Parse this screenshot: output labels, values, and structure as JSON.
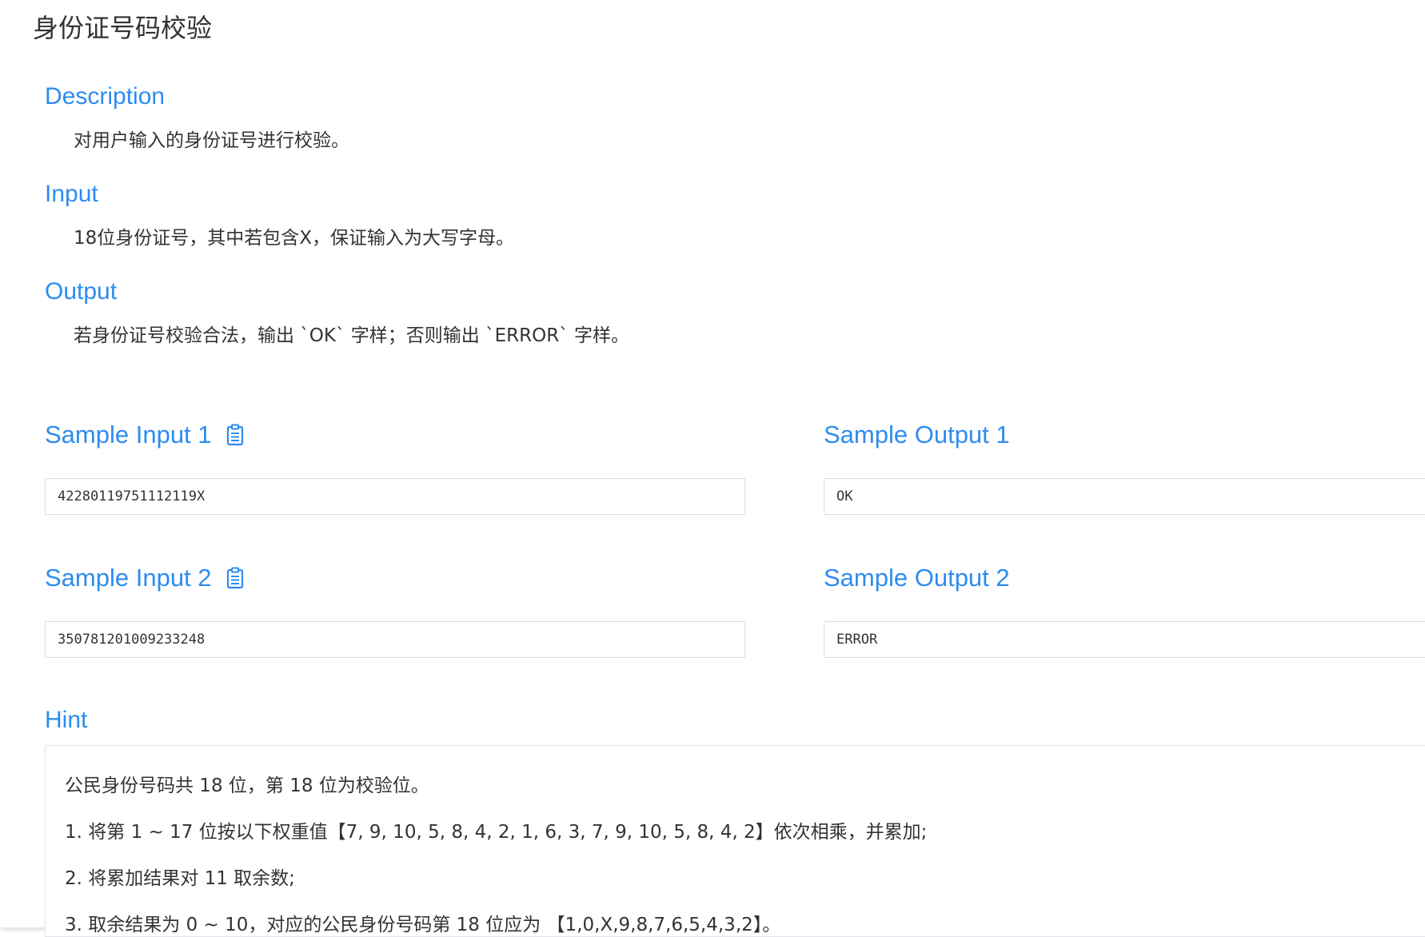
{
  "page": {
    "title": "身份证号码校验"
  },
  "description": {
    "heading": "Description",
    "text": "对用户输入的身份证号进行校验。"
  },
  "input": {
    "heading": "Input",
    "text": "18位身份证号，其中若包含X，保证输入为大写字母。"
  },
  "output": {
    "heading": "Output",
    "text": "若身份证号校验合法，输出 `OK` 字样；否则输出 `ERROR` 字样。"
  },
  "samples": [
    {
      "input_label": "Sample Input 1",
      "input_value": "42280119751112119X",
      "output_label": "Sample Output 1",
      "output_value": "OK"
    },
    {
      "input_label": "Sample Input 2",
      "input_value": "350781201009233248",
      "output_label": "Sample Output 2",
      "output_value": "ERROR"
    }
  ],
  "hint": {
    "heading": "Hint",
    "lines": [
      "公民身份号码共 18 位，第 18 位为校验位。",
      "1. 将第 1 ~ 17 位按以下权重值【7, 9, 10, 5, 8, 4, 2, 1, 6, 3, 7, 9, 10, 5, 8, 4, 2】依次相乘，并累加;",
      "2. 将累加结果对 11 取余数;",
      "3. 取余结果为 0 ~ 10，对应的公民身份号码第 18 位应为 【1,0,X,9,8,7,6,5,4,3,2】。"
    ]
  },
  "colors": {
    "accent": "#2d8cf0",
    "text": "#333333",
    "border": "#dcdee2"
  },
  "icons": {
    "copy": "clipboard-icon"
  }
}
